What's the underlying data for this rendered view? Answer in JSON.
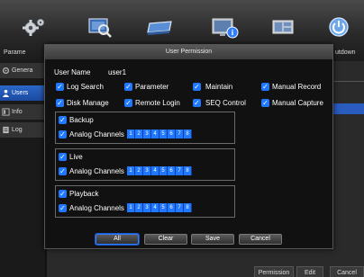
{
  "toolbar": {
    "items": [
      {
        "icon": "gear-icon",
        "label": "Parame"
      },
      {
        "icon": "search-icon",
        "label": ""
      },
      {
        "icon": "hdd-icon",
        "label": ""
      },
      {
        "icon": "system-info-icon",
        "label": ""
      },
      {
        "icon": "network-icon",
        "label": ""
      },
      {
        "icon": "power-icon",
        "label": "utdown"
      }
    ]
  },
  "sidebar": {
    "items": [
      {
        "label": "Genera",
        "icon": "gear-icon"
      },
      {
        "label": "Users",
        "icon": "user-icon",
        "active": true
      },
      {
        "label": "Info",
        "icon": "info-icon"
      },
      {
        "label": "Log",
        "icon": "log-icon"
      }
    ]
  },
  "bottom_buttons": {
    "permission": "Permission",
    "edit": "Edit",
    "cancel": "Cancel"
  },
  "dialog": {
    "title": "User Permission",
    "user_name_label": "User Name",
    "user_name_value": "user1",
    "permissions": {
      "log_search": "Log Search",
      "parameter": "Parameter",
      "maintain": "Maintain",
      "manual_record": "Manual Record",
      "disk_manage": "Disk Manage",
      "remote_login": "Remote Login",
      "seq_control": "SEQ Control",
      "manual_capture": "Manual Capture"
    },
    "groups": {
      "backup": {
        "title": "Backup",
        "channels_label": "Analog Channels",
        "channels": [
          "1",
          "2",
          "3",
          "4",
          "5",
          "6",
          "7",
          "8"
        ]
      },
      "live": {
        "title": "Live",
        "channels_label": "Analog Channels",
        "channels": [
          "1",
          "2",
          "3",
          "4",
          "5",
          "6",
          "7",
          "8"
        ]
      },
      "playback": {
        "title": "Playback",
        "channels_label": "Analog Channels",
        "channels": [
          "1",
          "2",
          "3",
          "4",
          "5",
          "6",
          "7",
          "8"
        ]
      }
    },
    "buttons": {
      "all": "All",
      "clear": "Clear",
      "save": "Save",
      "cancel": "Cancel"
    }
  },
  "colors": {
    "accent": "#1f78ff",
    "selected_bar": "#2b67c9",
    "dialog_bg": "#111111",
    "toolbar_bg": "#3a3a3a"
  }
}
